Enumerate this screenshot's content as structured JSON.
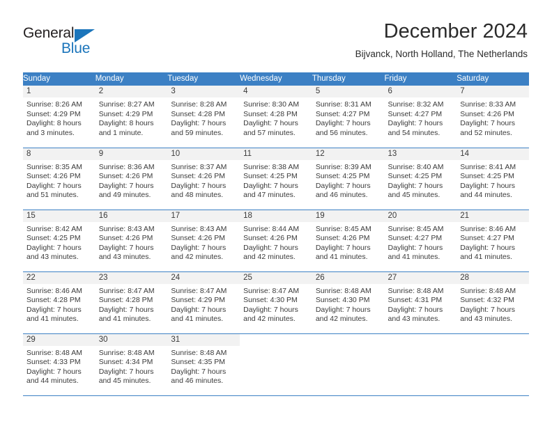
{
  "logo": {
    "word_top": "General",
    "word_bottom": "Blue",
    "triangle_color": "#1b75bb",
    "top_color": "#231f20",
    "bottom_color": "#1b75bb"
  },
  "header": {
    "title": "December 2024",
    "subtitle": "Bijvanck, North Holland, The Netherlands"
  },
  "theme": {
    "header_row_bg": "#3c80c4",
    "header_row_text": "#ffffff",
    "daynum_band_bg": "#f2f2f2",
    "row_divider": "#3c80c4",
    "body_text": "#3a3a3a"
  },
  "weekday_headers": [
    "Sunday",
    "Monday",
    "Tuesday",
    "Wednesday",
    "Thursday",
    "Friday",
    "Saturday"
  ],
  "weeks": [
    [
      {
        "day": "1",
        "sunrise": "Sunrise: 8:26 AM",
        "sunset": "Sunset: 4:29 PM",
        "daylight_line1": "Daylight: 8 hours",
        "daylight_line2": "and 3 minutes."
      },
      {
        "day": "2",
        "sunrise": "Sunrise: 8:27 AM",
        "sunset": "Sunset: 4:29 PM",
        "daylight_line1": "Daylight: 8 hours",
        "daylight_line2": "and 1 minute."
      },
      {
        "day": "3",
        "sunrise": "Sunrise: 8:28 AM",
        "sunset": "Sunset: 4:28 PM",
        "daylight_line1": "Daylight: 7 hours",
        "daylight_line2": "and 59 minutes."
      },
      {
        "day": "4",
        "sunrise": "Sunrise: 8:30 AM",
        "sunset": "Sunset: 4:28 PM",
        "daylight_line1": "Daylight: 7 hours",
        "daylight_line2": "and 57 minutes."
      },
      {
        "day": "5",
        "sunrise": "Sunrise: 8:31 AM",
        "sunset": "Sunset: 4:27 PM",
        "daylight_line1": "Daylight: 7 hours",
        "daylight_line2": "and 56 minutes."
      },
      {
        "day": "6",
        "sunrise": "Sunrise: 8:32 AM",
        "sunset": "Sunset: 4:27 PM",
        "daylight_line1": "Daylight: 7 hours",
        "daylight_line2": "and 54 minutes."
      },
      {
        "day": "7",
        "sunrise": "Sunrise: 8:33 AM",
        "sunset": "Sunset: 4:26 PM",
        "daylight_line1": "Daylight: 7 hours",
        "daylight_line2": "and 52 minutes."
      }
    ],
    [
      {
        "day": "8",
        "sunrise": "Sunrise: 8:35 AM",
        "sunset": "Sunset: 4:26 PM",
        "daylight_line1": "Daylight: 7 hours",
        "daylight_line2": "and 51 minutes."
      },
      {
        "day": "9",
        "sunrise": "Sunrise: 8:36 AM",
        "sunset": "Sunset: 4:26 PM",
        "daylight_line1": "Daylight: 7 hours",
        "daylight_line2": "and 49 minutes."
      },
      {
        "day": "10",
        "sunrise": "Sunrise: 8:37 AM",
        "sunset": "Sunset: 4:26 PM",
        "daylight_line1": "Daylight: 7 hours",
        "daylight_line2": "and 48 minutes."
      },
      {
        "day": "11",
        "sunrise": "Sunrise: 8:38 AM",
        "sunset": "Sunset: 4:25 PM",
        "daylight_line1": "Daylight: 7 hours",
        "daylight_line2": "and 47 minutes."
      },
      {
        "day": "12",
        "sunrise": "Sunrise: 8:39 AM",
        "sunset": "Sunset: 4:25 PM",
        "daylight_line1": "Daylight: 7 hours",
        "daylight_line2": "and 46 minutes."
      },
      {
        "day": "13",
        "sunrise": "Sunrise: 8:40 AM",
        "sunset": "Sunset: 4:25 PM",
        "daylight_line1": "Daylight: 7 hours",
        "daylight_line2": "and 45 minutes."
      },
      {
        "day": "14",
        "sunrise": "Sunrise: 8:41 AM",
        "sunset": "Sunset: 4:25 PM",
        "daylight_line1": "Daylight: 7 hours",
        "daylight_line2": "and 44 minutes."
      }
    ],
    [
      {
        "day": "15",
        "sunrise": "Sunrise: 8:42 AM",
        "sunset": "Sunset: 4:25 PM",
        "daylight_line1": "Daylight: 7 hours",
        "daylight_line2": "and 43 minutes."
      },
      {
        "day": "16",
        "sunrise": "Sunrise: 8:43 AM",
        "sunset": "Sunset: 4:26 PM",
        "daylight_line1": "Daylight: 7 hours",
        "daylight_line2": "and 43 minutes."
      },
      {
        "day": "17",
        "sunrise": "Sunrise: 8:43 AM",
        "sunset": "Sunset: 4:26 PM",
        "daylight_line1": "Daylight: 7 hours",
        "daylight_line2": "and 42 minutes."
      },
      {
        "day": "18",
        "sunrise": "Sunrise: 8:44 AM",
        "sunset": "Sunset: 4:26 PM",
        "daylight_line1": "Daylight: 7 hours",
        "daylight_line2": "and 42 minutes."
      },
      {
        "day": "19",
        "sunrise": "Sunrise: 8:45 AM",
        "sunset": "Sunset: 4:26 PM",
        "daylight_line1": "Daylight: 7 hours",
        "daylight_line2": "and 41 minutes."
      },
      {
        "day": "20",
        "sunrise": "Sunrise: 8:45 AM",
        "sunset": "Sunset: 4:27 PM",
        "daylight_line1": "Daylight: 7 hours",
        "daylight_line2": "and 41 minutes."
      },
      {
        "day": "21",
        "sunrise": "Sunrise: 8:46 AM",
        "sunset": "Sunset: 4:27 PM",
        "daylight_line1": "Daylight: 7 hours",
        "daylight_line2": "and 41 minutes."
      }
    ],
    [
      {
        "day": "22",
        "sunrise": "Sunrise: 8:46 AM",
        "sunset": "Sunset: 4:28 PM",
        "daylight_line1": "Daylight: 7 hours",
        "daylight_line2": "and 41 minutes."
      },
      {
        "day": "23",
        "sunrise": "Sunrise: 8:47 AM",
        "sunset": "Sunset: 4:28 PM",
        "daylight_line1": "Daylight: 7 hours",
        "daylight_line2": "and 41 minutes."
      },
      {
        "day": "24",
        "sunrise": "Sunrise: 8:47 AM",
        "sunset": "Sunset: 4:29 PM",
        "daylight_line1": "Daylight: 7 hours",
        "daylight_line2": "and 41 minutes."
      },
      {
        "day": "25",
        "sunrise": "Sunrise: 8:47 AM",
        "sunset": "Sunset: 4:30 PM",
        "daylight_line1": "Daylight: 7 hours",
        "daylight_line2": "and 42 minutes."
      },
      {
        "day": "26",
        "sunrise": "Sunrise: 8:48 AM",
        "sunset": "Sunset: 4:30 PM",
        "daylight_line1": "Daylight: 7 hours",
        "daylight_line2": "and 42 minutes."
      },
      {
        "day": "27",
        "sunrise": "Sunrise: 8:48 AM",
        "sunset": "Sunset: 4:31 PM",
        "daylight_line1": "Daylight: 7 hours",
        "daylight_line2": "and 43 minutes."
      },
      {
        "day": "28",
        "sunrise": "Sunrise: 8:48 AM",
        "sunset": "Sunset: 4:32 PM",
        "daylight_line1": "Daylight: 7 hours",
        "daylight_line2": "and 43 minutes."
      }
    ],
    [
      {
        "day": "29",
        "sunrise": "Sunrise: 8:48 AM",
        "sunset": "Sunset: 4:33 PM",
        "daylight_line1": "Daylight: 7 hours",
        "daylight_line2": "and 44 minutes."
      },
      {
        "day": "30",
        "sunrise": "Sunrise: 8:48 AM",
        "sunset": "Sunset: 4:34 PM",
        "daylight_line1": "Daylight: 7 hours",
        "daylight_line2": "and 45 minutes."
      },
      {
        "day": "31",
        "sunrise": "Sunrise: 8:48 AM",
        "sunset": "Sunset: 4:35 PM",
        "daylight_line1": "Daylight: 7 hours",
        "daylight_line2": "and 46 minutes."
      },
      {
        "day": "",
        "sunrise": "",
        "sunset": "",
        "daylight_line1": "",
        "daylight_line2": ""
      },
      {
        "day": "",
        "sunrise": "",
        "sunset": "",
        "daylight_line1": "",
        "daylight_line2": ""
      },
      {
        "day": "",
        "sunrise": "",
        "sunset": "",
        "daylight_line1": "",
        "daylight_line2": ""
      },
      {
        "day": "",
        "sunrise": "",
        "sunset": "",
        "daylight_line1": "",
        "daylight_line2": ""
      }
    ]
  ]
}
